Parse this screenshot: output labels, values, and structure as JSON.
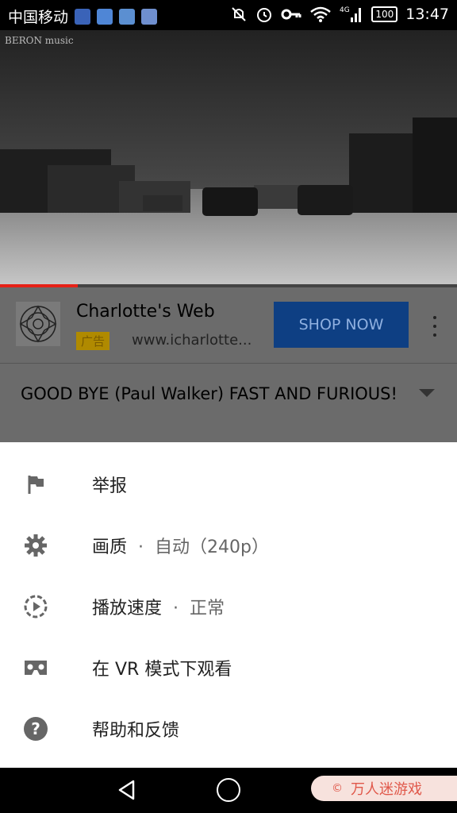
{
  "status_bar": {
    "carrier": "中国移动",
    "network": "4G",
    "battery": "100",
    "time": "13:47"
  },
  "video": {
    "watermark": "BERON music",
    "progress_fraction": 0.17
  },
  "ad": {
    "title": "Charlotte's Web",
    "badge": "广告",
    "url": "www.icharlotte...",
    "cta": "SHOP NOW"
  },
  "video_title": "GOOD BYE (Paul Walker) FAST AND FURIOUS!",
  "menu": {
    "items": [
      {
        "label": "举报",
        "icon": "flag-icon"
      },
      {
        "label": "画质",
        "separator": "·",
        "value": "自动（240p）",
        "icon": "gear-icon"
      },
      {
        "label": "播放速度",
        "separator": "·",
        "value": "正常",
        "icon": "playback-speed-icon"
      },
      {
        "label": "在 VR 模式下观看",
        "icon": "vr-headset-icon"
      },
      {
        "label": "帮助和反馈",
        "icon": "help-icon"
      }
    ]
  },
  "brand_overlay": {
    "symbol": "©",
    "text": "万人迷游戏"
  },
  "colors": {
    "accent_red": "#e62117",
    "ad_button": "#0e3f83",
    "ad_badge": "#b08a00"
  }
}
